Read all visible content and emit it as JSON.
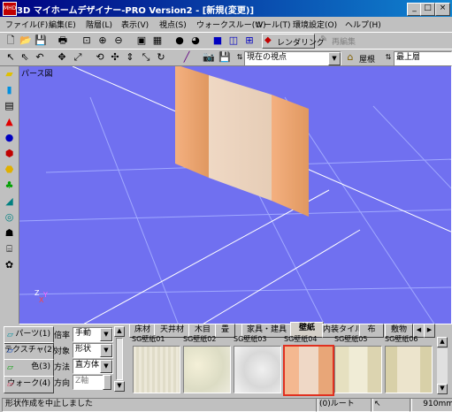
{
  "title": "3D マイホームデザイナー-PRO Version2 - [新規(変更)]",
  "menu": [
    "ファイル(F)",
    "編集(E)",
    "階層(L)",
    "表示(V)",
    "視点(S)",
    "ウォークスルー(W)",
    "ツール(T)",
    "環境設定(O)",
    "ヘルプ(H)"
  ],
  "toolbar": {
    "render_label": "レンダリング",
    "reedit_label": "再編集",
    "viewpoint_select": "現在の視点",
    "roof_label": "屋根",
    "floor_select": "最上層"
  },
  "viewport": {
    "label": "パース図",
    "axis_x": "X",
    "axis_y": "Y",
    "axis_z": "Z"
  },
  "modes": [
    "パーツ(1)",
    "テクスチャ(2)",
    "色(3)",
    "ウォーク(4)"
  ],
  "options": [
    {
      "label": "倍率",
      "value": "手動"
    },
    {
      "label": "対象",
      "value": "形状"
    },
    {
      "label": "方法",
      "value": "直方体"
    },
    {
      "label": "方向",
      "value": "Z軸"
    }
  ],
  "tabs": [
    "床材",
    "天井材",
    "木目",
    "畳",
    "家具・建具",
    "壁紙",
    "内装タイル",
    "布",
    "敷物"
  ],
  "active_tab": "壁紙",
  "thumbnails": [
    "SG壁紙01",
    "SG壁紙02",
    "SG壁紙03",
    "SG壁紙04",
    "SG壁紙05",
    "SG壁紙06"
  ],
  "selected_thumbnail": "SG壁紙04",
  "status": {
    "message": "形状作成を中止しました",
    "root": "(0)ルート",
    "size": "910mm"
  },
  "colors": {
    "viewport_bg": "#7070f0",
    "selection": "#e03020",
    "title_start": "#000080"
  }
}
